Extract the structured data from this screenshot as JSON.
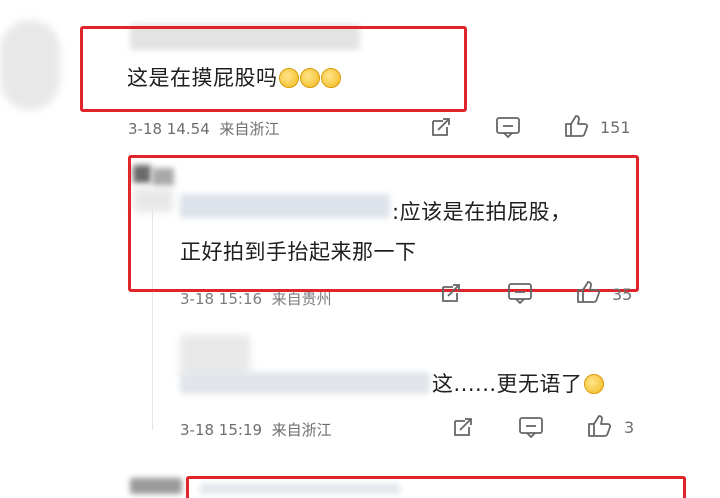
{
  "comments": [
    {
      "text": "这是在摸屁股吗",
      "date": "3-18 14.54",
      "location": "来自浙江",
      "likes": "151"
    },
    {
      "text_line1": ":应该是在拍屁股，",
      "text_line2": "正好拍到手抬起来那一下",
      "date": "3-18 15:16",
      "location": "来自贵州",
      "likes": "35"
    },
    {
      "text": "这......更无语了",
      "date": "3-18 15:19",
      "location": "来自浙江",
      "likes": "3"
    }
  ],
  "colors": {
    "highlight": "#e0242b",
    "meta": "#6e6e6e"
  }
}
